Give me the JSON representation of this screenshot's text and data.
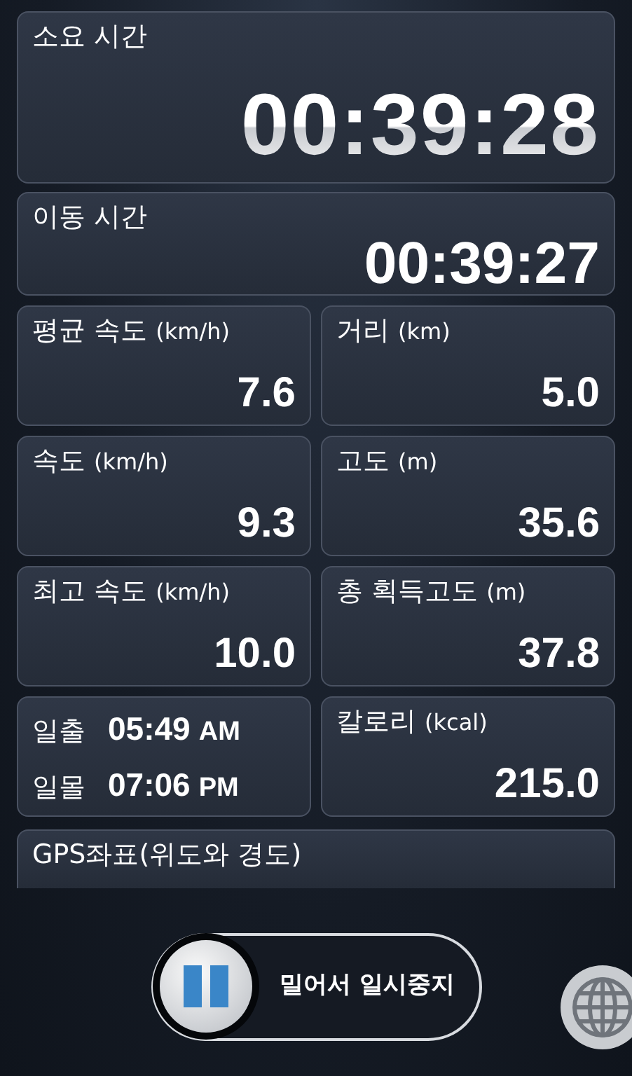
{
  "timers": [
    {
      "kind": "large",
      "label": "소요 시간",
      "value": "00:39:28"
    },
    {
      "kind": "medium",
      "label": "이동 시간",
      "value": "00:39:27"
    }
  ],
  "stats": [
    {
      "kind": "stat",
      "label": "평균 속도",
      "unit": "(km/h)",
      "value": "7.6"
    },
    {
      "kind": "stat",
      "label": "거리",
      "unit": "(km)",
      "value": "5.0"
    },
    {
      "kind": "stat",
      "label": "속도",
      "unit": "(km/h)",
      "value": "9.3"
    },
    {
      "kind": "stat",
      "label": "고도",
      "unit": "(m)",
      "value": "35.6"
    },
    {
      "kind": "stat",
      "label": "최고 속도",
      "unit": "(km/h)",
      "value": "10.0"
    },
    {
      "kind": "stat",
      "label": "총 획득고도",
      "unit": "(m)",
      "value": "37.8"
    },
    {
      "kind": "sun",
      "rows": [
        {
          "label": "일출",
          "time": "05:49",
          "suffix": "AM"
        },
        {
          "label": "일몰",
          "time": "07:06",
          "suffix": "PM"
        }
      ]
    },
    {
      "kind": "stat",
      "label": "칼로리",
      "unit": "(kcal)",
      "value": "215.0"
    }
  ],
  "gps": {
    "label": "GPS좌표(위도와 경도)"
  },
  "slider": {
    "label": "밀어서 일시중지",
    "level": 0
  }
}
